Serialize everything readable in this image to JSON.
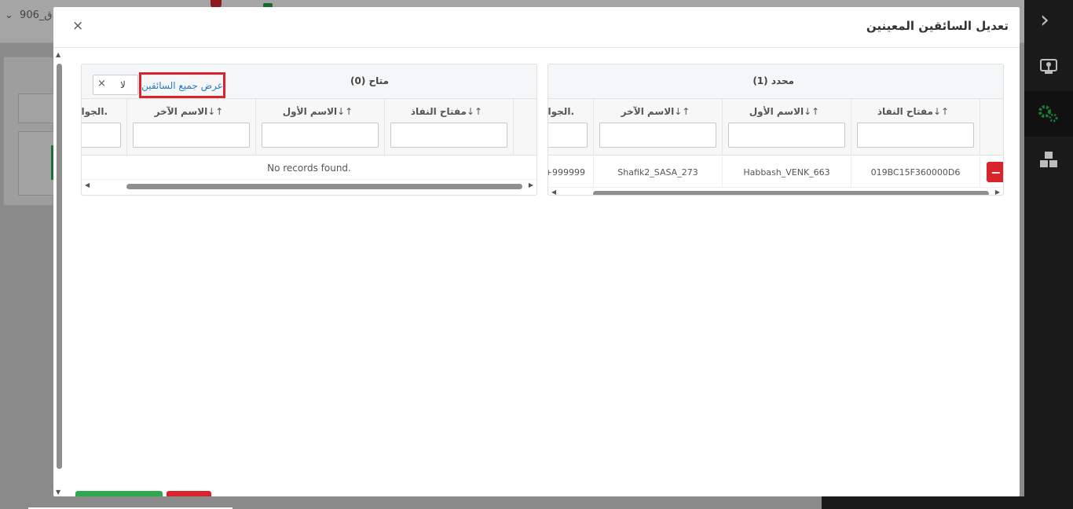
{
  "background": {
    "selector_text": "ق_906",
    "accent_green": "#1f6e35",
    "sidebar_icons": [
      "map-pin-icon",
      "gears-icon",
      "cubes-icon"
    ]
  },
  "modal": {
    "title": "تعديل السائقين المعينين",
    "close_label": "×"
  },
  "selected_panel": {
    "title": "محدد (1)",
    "columns": [
      "مفتاح النفاذ",
      "الاسم الأول",
      "الاسم الآخر",
      "الجوال."
    ],
    "sort_glyph": "↓↑",
    "rows": [
      {
        "access_key": "019BC15F360000D6",
        "first_name": "Habbash_VENK_663",
        "last_name": "Shafik2_SASA_273",
        "mobile": "+999999"
      }
    ],
    "remove_label": "−"
  },
  "available_panel": {
    "title": "متاح (0)",
    "columns": [
      "مفتاح النفاذ",
      "الاسم الأول",
      "الاسم الآخر",
      "الجوال."
    ],
    "sort_glyph": "↓↑",
    "show_all_label": "عرض جميع السائقين",
    "toggle_value": "لا",
    "toggle_clear": "×",
    "empty_text": "No records found."
  },
  "colors": {
    "save": "#2eaa4e",
    "cancel": "#d9242b",
    "highlight": "#e0212b",
    "link": "#2d7cc0"
  }
}
